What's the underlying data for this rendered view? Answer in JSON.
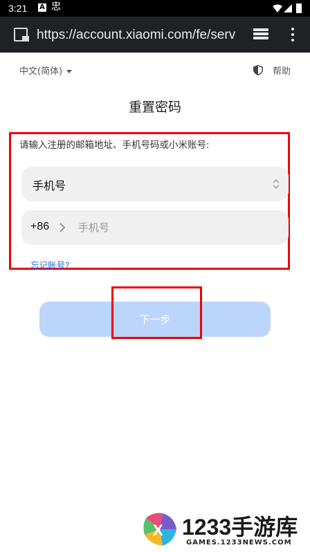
{
  "status_bar": {
    "time": "3:21",
    "notification_a": "A",
    "notification_game": "忠"
  },
  "browser": {
    "url": "https://account.xiaomi.com/fe/serv",
    "site_icon": "site-info-lock-icon",
    "tabs_icon": "tabs-stack-icon",
    "menu_icon": "more-vert-icon"
  },
  "header": {
    "language": "中文(简体)",
    "help": "帮助"
  },
  "main": {
    "title": "重置密码",
    "instruction": "请输入注册的邮箱地址、手机号码或小米账号:",
    "account_type": {
      "selected": "手机号"
    },
    "phone": {
      "country_code": "+86",
      "value": "",
      "placeholder": "手机号"
    },
    "forgot_link": "忘记账号?",
    "next_button": "下一步"
  },
  "watermark": {
    "title": "1233手游库",
    "url": "GAMES.1233NEWS.COM"
  },
  "colors": {
    "accent_blue": "#2a6ad8",
    "button_disabled": "#bcd5fb",
    "highlight_red": "#ee0000",
    "field_bg": "#f0f0f0"
  }
}
